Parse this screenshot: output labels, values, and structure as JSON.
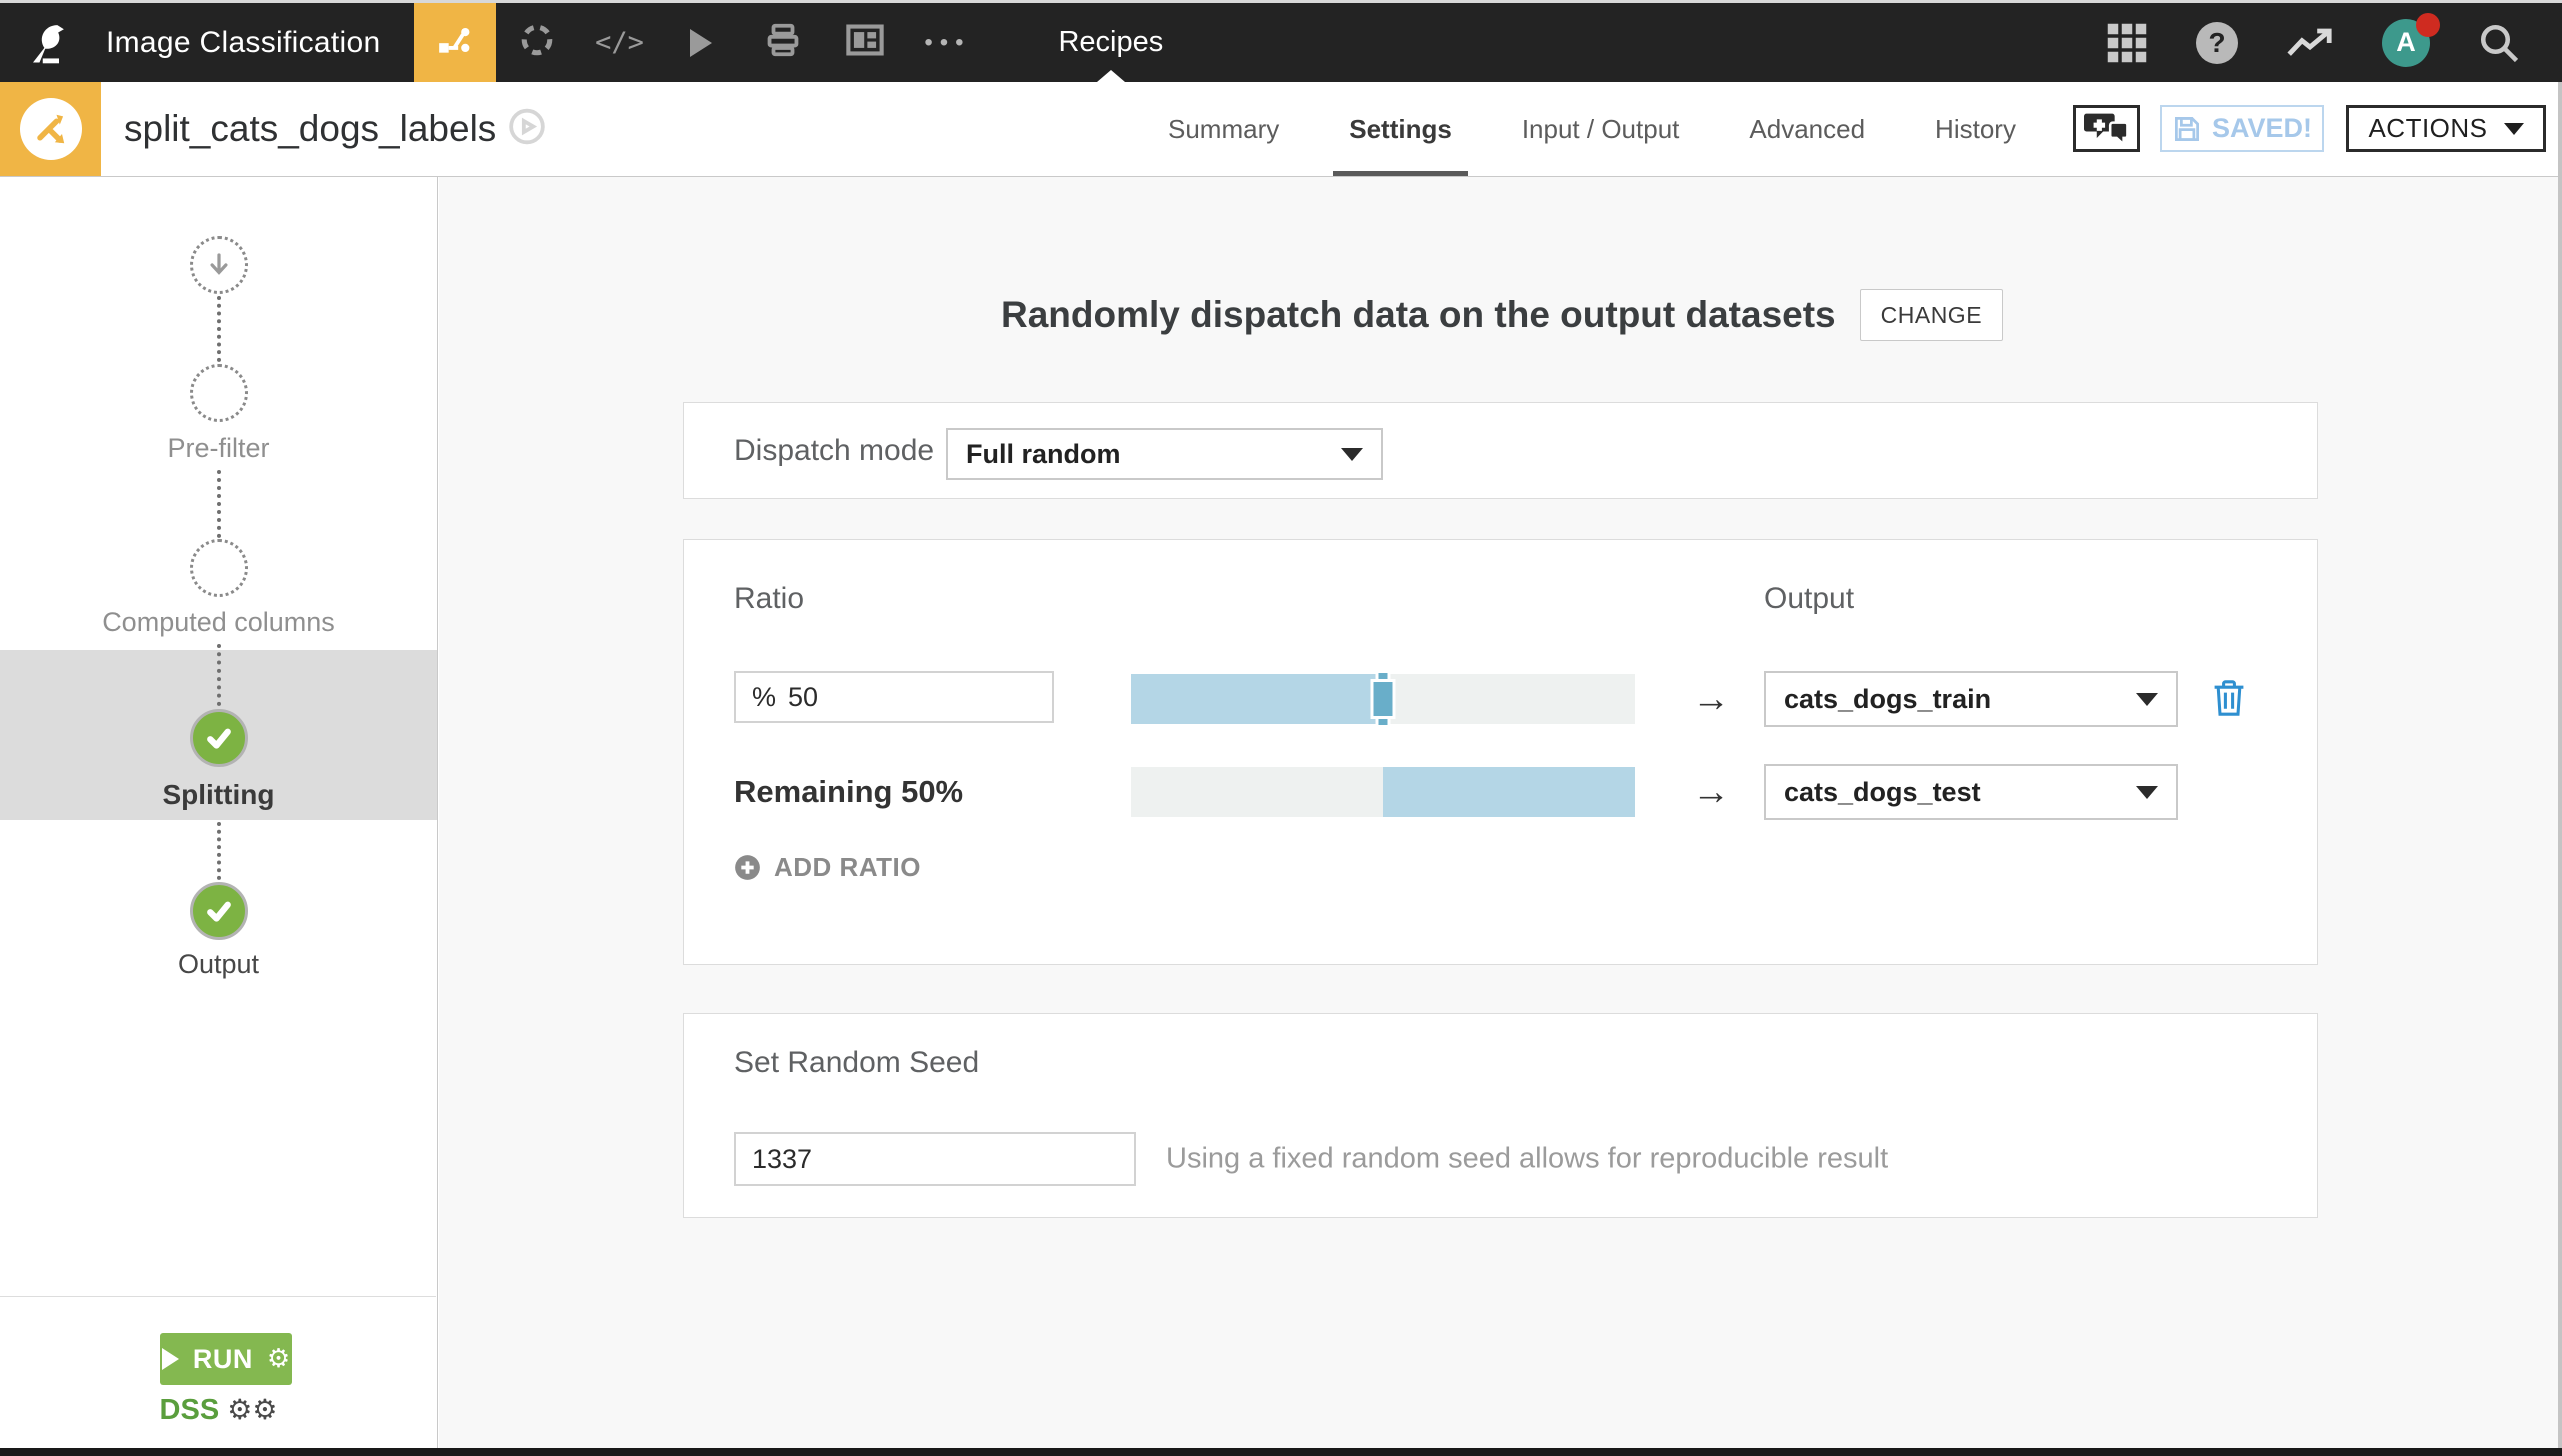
{
  "topnav": {
    "project_title": "Image Classification",
    "section_label": "Recipes",
    "avatar_initial": "A",
    "help_glyph": "?",
    "more_glyph": "•••",
    "code_glyph": "</>"
  },
  "header": {
    "recipe_title": "split_cats_dogs_labels",
    "tabs": [
      {
        "label": "Summary"
      },
      {
        "label": "Settings"
      },
      {
        "label": "Input / Output"
      },
      {
        "label": "Advanced"
      },
      {
        "label": "History"
      }
    ],
    "saved_label": "SAVED!",
    "actions_label": "ACTIONS"
  },
  "sidebar": {
    "steps": [
      {
        "label": "Pre-filter"
      },
      {
        "label": "Computed columns"
      },
      {
        "label": "Splitting"
      },
      {
        "label": "Output"
      }
    ],
    "run_label": "RUN",
    "run_gear": "⚙",
    "engine_label": "DSS",
    "engine_gears": "⚙⚙"
  },
  "main": {
    "title": "Randomly dispatch data on the output datasets",
    "change_label": "CHANGE",
    "dispatch_mode": {
      "label": "Dispatch mode",
      "value": "Full random"
    },
    "ratio": {
      "ratio_header": "Ratio",
      "output_header": "Output",
      "row1": {
        "percent_prefix": "%",
        "percent_value": "50",
        "output_dataset": "cats_dogs_train",
        "fill_percent": 50,
        "arrow": "→"
      },
      "row2": {
        "label": "Remaining 50%",
        "output_dataset": "cats_dogs_test",
        "fill_percent": 50,
        "arrow": "→"
      },
      "add_ratio_label": "ADD RATIO"
    },
    "seed": {
      "header": "Set Random Seed",
      "value": "1337",
      "helper": "Using a fixed random seed allows for reproducible result"
    }
  },
  "colors": {
    "accent_orange": "#f0b545",
    "success_green": "#7db343",
    "run_green": "#84b850",
    "slider_fill_blue": "#b4d6e6",
    "slider_handle_blue": "#69aec9",
    "saved_blue": "#a6c8ea",
    "trash_blue": "#2e8fd0",
    "avatar_teal": "#3d998c",
    "notification_red": "#cf2b20",
    "navbar_dark": "#232323",
    "active_row_gray": "#dcdcdc"
  }
}
